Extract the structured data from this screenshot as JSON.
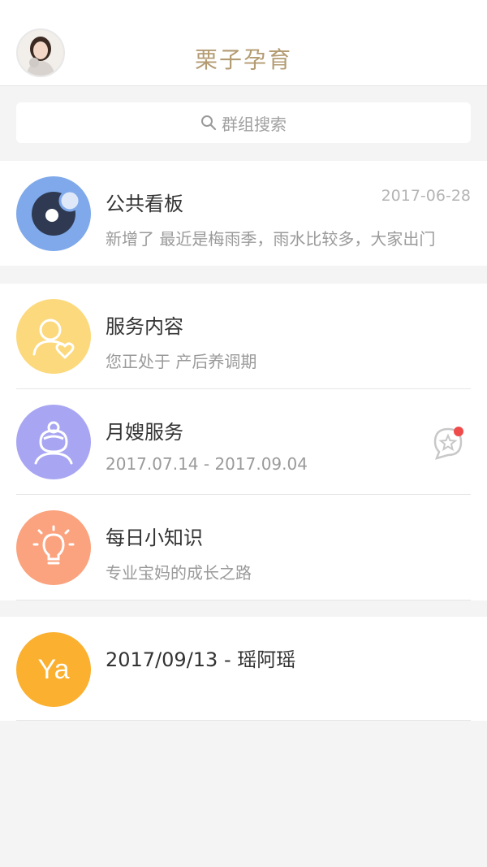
{
  "header": {
    "title": "栗子孕育",
    "avatar_icon": "user-avatar-photo"
  },
  "search": {
    "placeholder": "群组搜索",
    "icon": "search-icon"
  },
  "board": {
    "title": "公共看板",
    "date": "2017-06-28",
    "preview": "新增了 最近是梅雨季，雨水比较多，大家出门",
    "icon": "eye-icon",
    "color": "#7fa9ea"
  },
  "services": [
    {
      "title": "服务内容",
      "subtitle": "您正处于 产后养调期",
      "icon": "user-heart-icon",
      "color": "#fcd97c"
    },
    {
      "title": "月嫂服务",
      "subtitle": "2017.07.14 - 2017.09.04",
      "icon": "nanny-icon",
      "color": "#a8a6f3",
      "action_icon": "star-chat-icon",
      "badge_color": "#ef4b4b"
    },
    {
      "title": "每日小知识",
      "subtitle": "专业宝妈的成长之路",
      "icon": "lightbulb-icon",
      "color": "#fba37f"
    }
  ],
  "chat": {
    "title": "2017/09/13 - 瑶阿瑶",
    "avatar_text": "Ya",
    "color": "#fbb030"
  }
}
